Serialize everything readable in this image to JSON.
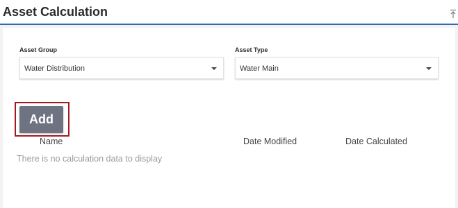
{
  "header": {
    "title": "Asset Calculation",
    "collapse_icon": "collapse-up-icon"
  },
  "filters": {
    "asset_group": {
      "label": "Asset Group",
      "value": "Water Distribution"
    },
    "asset_type": {
      "label": "Asset Type",
      "value": "Water Main"
    }
  },
  "actions": {
    "add_label": "Add"
  },
  "table": {
    "columns": [
      "Name",
      "Date Modified",
      "Date Calculated"
    ],
    "empty_message": "There is no calculation data to display"
  },
  "colors": {
    "header_underline": "#2e6bb3",
    "add_button": "#6d7380",
    "highlight_border": "#a31c22"
  }
}
